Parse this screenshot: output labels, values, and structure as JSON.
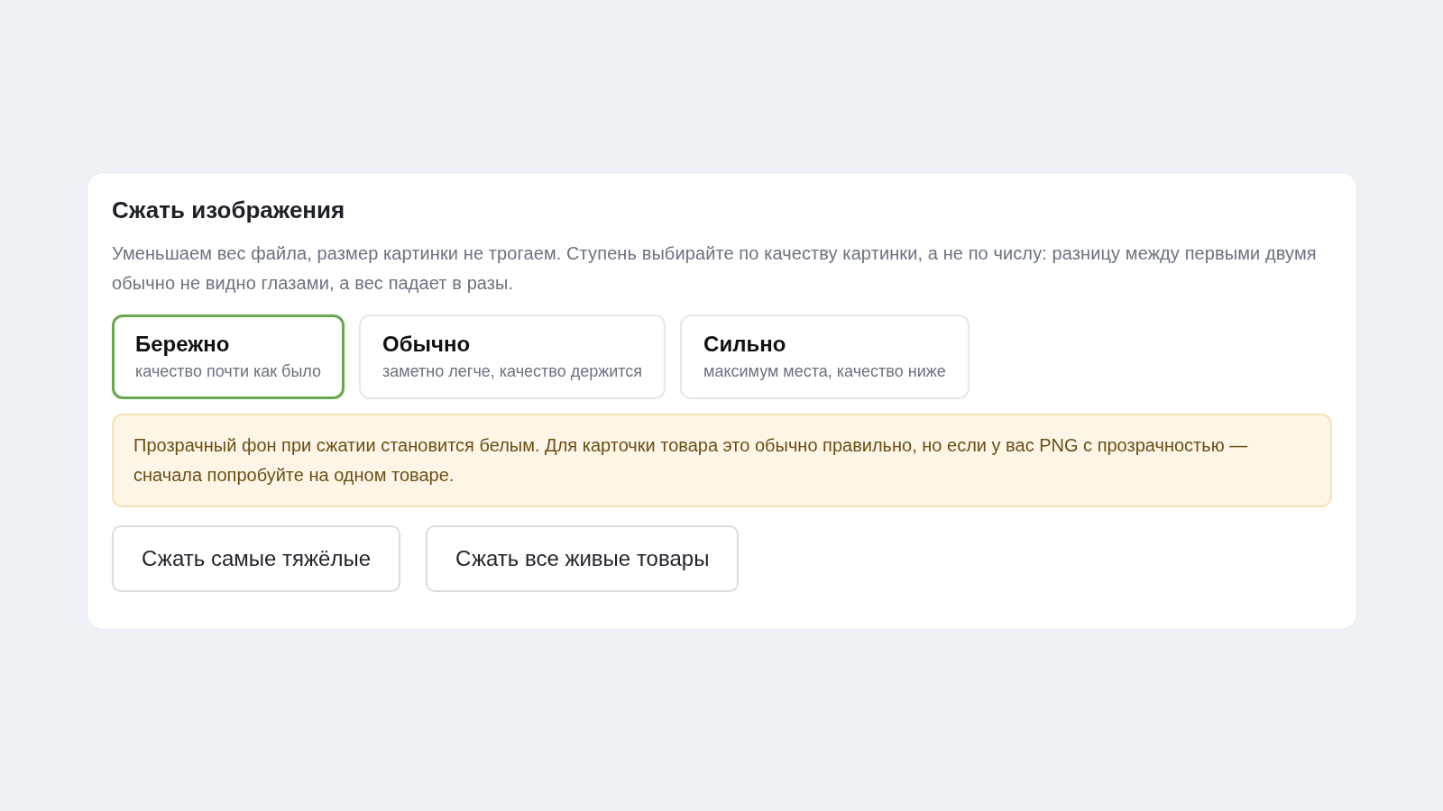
{
  "card": {
    "title": "Сжать изображения",
    "description": "Уменьшаем вес файла, размер картинки не трогаем. Ступень выбирайте по качеству картинки, а не по числу: разницу между первыми двумя обычно не видно глазами, а вес падает в разы.",
    "levels": [
      {
        "label": "Бережно",
        "hint": "качество почти как было",
        "selected": true
      },
      {
        "label": "Обычно",
        "hint": "заметно легче, качество держится",
        "selected": false
      },
      {
        "label": "Сильно",
        "hint": "максимум места, качество ниже",
        "selected": false
      }
    ],
    "warning": "Прозрачный фон при сжатии становится белым. Для карточки товара это обычно правильно, но если у вас PNG с прозрачностью — сначала попробуйте на одном товаре.",
    "buttons": [
      "Сжать самые тяжёлые",
      "Сжать все живые товары"
    ]
  }
}
